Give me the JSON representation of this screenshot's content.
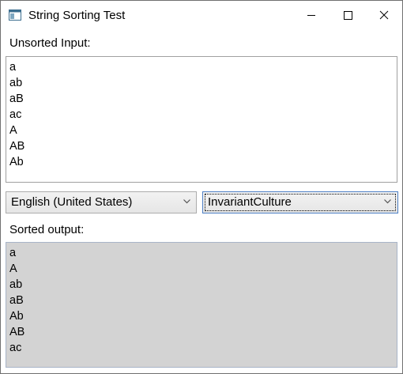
{
  "window": {
    "title": "String Sorting Test"
  },
  "unsorted": {
    "label": "Unsorted Input:",
    "lines": [
      "a",
      "ab",
      "aB",
      "ac",
      "A",
      "AB",
      "Ab"
    ]
  },
  "culture_select": {
    "selected": "English (United States)"
  },
  "compare_select": {
    "selected": "InvariantCulture"
  },
  "sorted": {
    "label": "Sorted output:",
    "lines": [
      "a",
      "A",
      "ab",
      "aB",
      "Ab",
      "AB",
      "ac"
    ]
  },
  "icons": {
    "app": "window-icon",
    "minimize": "minimize-icon",
    "maximize": "maximize-icon",
    "close": "close-icon",
    "dropdown": "chevron-down-icon"
  },
  "colors": {
    "output_background": "#d3d3d3",
    "focus_border": "#4d7fc4"
  }
}
